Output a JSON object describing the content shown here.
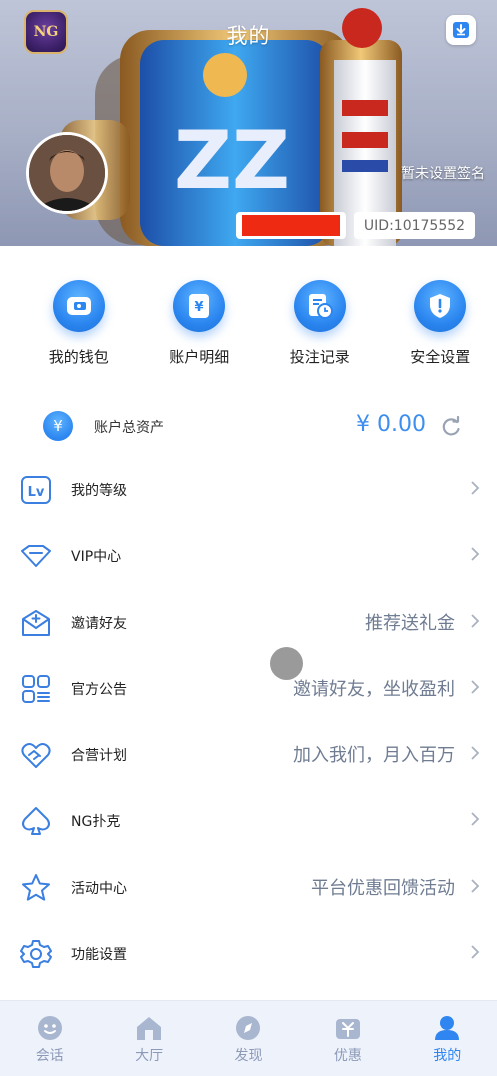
{
  "header": {
    "title": "我的",
    "logo_text": "NG",
    "signature": "暂未设置签名",
    "uid": "UID:10175552"
  },
  "quick_actions": [
    {
      "label": "我的钱包",
      "icon": "wallet-icon"
    },
    {
      "label": "账户明细",
      "icon": "yen-document-icon"
    },
    {
      "label": "投注记录",
      "icon": "clock-document-icon"
    },
    {
      "label": "安全设置",
      "icon": "shield-icon"
    }
  ],
  "assets": {
    "label": "账户总资产",
    "value": "¥ 0.00",
    "icon": "yen-icon"
  },
  "menu": [
    {
      "label": "我的等级",
      "extra": "",
      "icon": "level-icon"
    },
    {
      "label": "VIP中心",
      "extra": "",
      "icon": "vip-diamond-icon"
    },
    {
      "label": "邀请好友",
      "extra": "推荐送礼金",
      "icon": "invite-mail-icon"
    },
    {
      "label": "官方公告",
      "extra": "邀请好友，坐收盈利",
      "icon": "announcement-grid-icon"
    },
    {
      "label": "合营计划",
      "extra": "加入我们，月入百万",
      "icon": "partner-handshake-icon"
    },
    {
      "label": "NG扑克",
      "extra": "",
      "icon": "poker-spade-icon"
    },
    {
      "label": "活动中心",
      "extra": "平台优惠回馈活动",
      "icon": "star-icon"
    },
    {
      "label": "功能设置",
      "extra": "",
      "icon": "settings-gear-icon"
    }
  ],
  "tabbar": [
    {
      "label": "会话",
      "icon": "chat-face-icon",
      "active": false
    },
    {
      "label": "大厅",
      "icon": "home-icon",
      "active": false
    },
    {
      "label": "发现",
      "icon": "compass-icon",
      "active": false
    },
    {
      "label": "优惠",
      "icon": "gift-icon",
      "active": false
    },
    {
      "label": "我的",
      "icon": "profile-icon",
      "active": true
    }
  ],
  "colors": {
    "accent": "#2f86f0",
    "tab_inactive": "#8c9ab8",
    "redaction": "#ee2a12"
  }
}
